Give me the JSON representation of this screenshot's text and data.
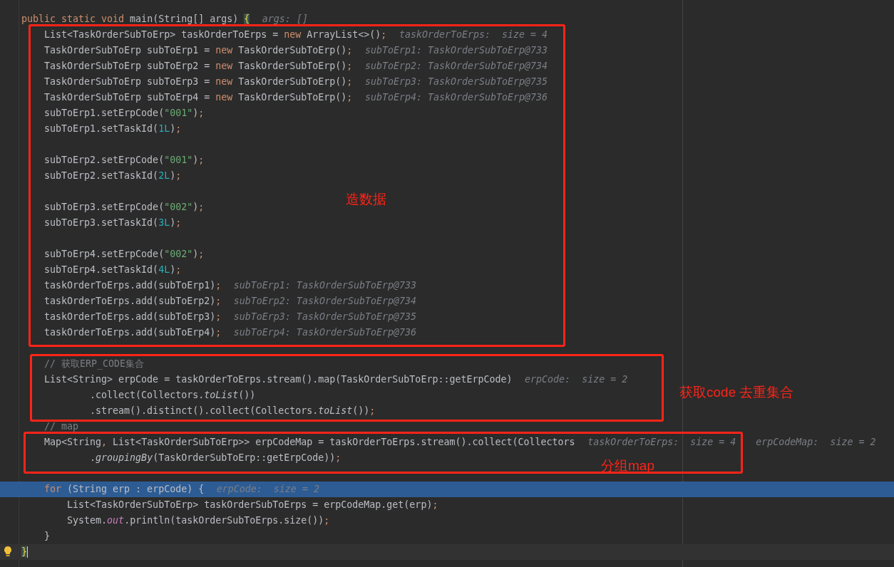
{
  "editor": {
    "lines": [
      {
        "kind": "code",
        "tokens": [
          {
            "kind": "kw",
            "text": "public static void "
          },
          {
            "kind": "p",
            "text": "main(String[] args) "
          },
          {
            "kind": "brace",
            "text": "{"
          }
        ],
        "hints": [
          "args: []"
        ]
      },
      {
        "kind": "code",
        "tokens": [
          {
            "kind": "p",
            "text": "    List<TaskOrderSubToErp> taskOrderToErps = "
          },
          {
            "kind": "kw",
            "text": "new "
          },
          {
            "kind": "p",
            "text": "ArrayList<>()"
          },
          {
            "kind": "kw",
            "text": ";"
          }
        ],
        "hints": [
          "taskOrderToErps:  size = 4"
        ]
      },
      {
        "kind": "code",
        "tokens": [
          {
            "kind": "p",
            "text": "    TaskOrderSubToErp subToErp1 = "
          },
          {
            "kind": "kw",
            "text": "new "
          },
          {
            "kind": "p",
            "text": "TaskOrderSubToErp()"
          },
          {
            "kind": "kw",
            "text": ";"
          }
        ],
        "hints": [
          "subToErp1: TaskOrderSubToErp@733"
        ]
      },
      {
        "kind": "code",
        "tokens": [
          {
            "kind": "p",
            "text": "    TaskOrderSubToErp subToErp2 = "
          },
          {
            "kind": "kw",
            "text": "new "
          },
          {
            "kind": "p",
            "text": "TaskOrderSubToErp()"
          },
          {
            "kind": "kw",
            "text": ";"
          }
        ],
        "hints": [
          "subToErp2: TaskOrderSubToErp@734"
        ]
      },
      {
        "kind": "code",
        "tokens": [
          {
            "kind": "p",
            "text": "    TaskOrderSubToErp subToErp3 = "
          },
          {
            "kind": "kw",
            "text": "new "
          },
          {
            "kind": "p",
            "text": "TaskOrderSubToErp()"
          },
          {
            "kind": "kw",
            "text": ";"
          }
        ],
        "hints": [
          "subToErp3: TaskOrderSubToErp@735"
        ]
      },
      {
        "kind": "code",
        "tokens": [
          {
            "kind": "p",
            "text": "    TaskOrderSubToErp subToErp4 = "
          },
          {
            "kind": "kw",
            "text": "new "
          },
          {
            "kind": "p",
            "text": "TaskOrderSubToErp()"
          },
          {
            "kind": "kw",
            "text": ";"
          }
        ],
        "hints": [
          "subToErp4: TaskOrderSubToErp@736"
        ]
      },
      {
        "kind": "code",
        "tokens": [
          {
            "kind": "p",
            "text": "    subToErp1.setErpCode("
          },
          {
            "kind": "str",
            "text": "\"001\""
          },
          {
            "kind": "p",
            "text": ")"
          },
          {
            "kind": "kw",
            "text": ";"
          }
        ]
      },
      {
        "kind": "code",
        "tokens": [
          {
            "kind": "p",
            "text": "    subToErp1.setTaskId("
          },
          {
            "kind": "num",
            "text": "1L"
          },
          {
            "kind": "p",
            "text": ")"
          },
          {
            "kind": "kw",
            "text": ";"
          }
        ]
      },
      {
        "kind": "blank"
      },
      {
        "kind": "code",
        "tokens": [
          {
            "kind": "p",
            "text": "    subToErp2.setErpCode("
          },
          {
            "kind": "str",
            "text": "\"001\""
          },
          {
            "kind": "p",
            "text": ")"
          },
          {
            "kind": "kw",
            "text": ";"
          }
        ]
      },
      {
        "kind": "code",
        "tokens": [
          {
            "kind": "p",
            "text": "    subToErp2.setTaskId("
          },
          {
            "kind": "num",
            "text": "2L"
          },
          {
            "kind": "p",
            "text": ")"
          },
          {
            "kind": "kw",
            "text": ";"
          }
        ]
      },
      {
        "kind": "blank"
      },
      {
        "kind": "code",
        "tokens": [
          {
            "kind": "p",
            "text": "    subToErp3.setErpCode("
          },
          {
            "kind": "str",
            "text": "\"002\""
          },
          {
            "kind": "p",
            "text": ")"
          },
          {
            "kind": "kw",
            "text": ";"
          }
        ]
      },
      {
        "kind": "code",
        "tokens": [
          {
            "kind": "p",
            "text": "    subToErp3.setTaskId("
          },
          {
            "kind": "num",
            "text": "3L"
          },
          {
            "kind": "p",
            "text": ")"
          },
          {
            "kind": "kw",
            "text": ";"
          }
        ]
      },
      {
        "kind": "blank"
      },
      {
        "kind": "code",
        "tokens": [
          {
            "kind": "p",
            "text": "    subToErp4.setErpCode("
          },
          {
            "kind": "str",
            "text": "\"002\""
          },
          {
            "kind": "p",
            "text": ")"
          },
          {
            "kind": "kw",
            "text": ";"
          }
        ]
      },
      {
        "kind": "code",
        "tokens": [
          {
            "kind": "p",
            "text": "    subToErp4.setTaskId("
          },
          {
            "kind": "num",
            "text": "4L"
          },
          {
            "kind": "p",
            "text": ")"
          },
          {
            "kind": "kw",
            "text": ";"
          }
        ]
      },
      {
        "kind": "code",
        "tokens": [
          {
            "kind": "p",
            "text": "    taskOrderToErps.add(subToErp1)"
          },
          {
            "kind": "kw",
            "text": ";"
          }
        ],
        "hints": [
          "subToErp1: TaskOrderSubToErp@733"
        ]
      },
      {
        "kind": "code",
        "tokens": [
          {
            "kind": "p",
            "text": "    taskOrderToErps.add(subToErp2)"
          },
          {
            "kind": "kw",
            "text": ";"
          }
        ],
        "hints": [
          "subToErp2: TaskOrderSubToErp@734"
        ]
      },
      {
        "kind": "code",
        "tokens": [
          {
            "kind": "p",
            "text": "    taskOrderToErps.add(subToErp3)"
          },
          {
            "kind": "kw",
            "text": ";"
          }
        ],
        "hints": [
          "subToErp3: TaskOrderSubToErp@735"
        ]
      },
      {
        "kind": "code",
        "tokens": [
          {
            "kind": "p",
            "text": "    taskOrderToErps.add(subToErp4)"
          },
          {
            "kind": "kw",
            "text": ";"
          }
        ],
        "hints": [
          "subToErp4: TaskOrderSubToErp@736"
        ]
      },
      {
        "kind": "blank"
      },
      {
        "kind": "code",
        "tokens": [
          {
            "kind": "cm",
            "text": "    // 获取ERP_CODE集合"
          }
        ]
      },
      {
        "kind": "code",
        "tokens": [
          {
            "kind": "p",
            "text": "    List<String> erpCode = taskOrderToErps.stream().map(TaskOrderSubToErp::getErpCode)"
          }
        ],
        "hints": [
          "erpCode:  size = 2"
        ]
      },
      {
        "kind": "code",
        "tokens": [
          {
            "kind": "p",
            "text": "            .collect(Collectors."
          },
          {
            "kind": "it",
            "text": "toList"
          },
          {
            "kind": "p",
            "text": "())"
          }
        ]
      },
      {
        "kind": "code",
        "tokens": [
          {
            "kind": "p",
            "text": "            .stream().distinct().collect(Collectors."
          },
          {
            "kind": "it",
            "text": "toList"
          },
          {
            "kind": "p",
            "text": "())"
          },
          {
            "kind": "kw",
            "text": ";"
          }
        ]
      },
      {
        "kind": "code",
        "tokens": [
          {
            "kind": "cm",
            "text": "    // map"
          }
        ]
      },
      {
        "kind": "code",
        "tokens": [
          {
            "kind": "p",
            "text": "    Map<String"
          },
          {
            "kind": "kw",
            "text": ","
          },
          {
            "kind": "p",
            "text": " List<TaskOrderSubToErp>> erpCodeMap = taskOrderToErps.stream().collect(Collectors"
          }
        ],
        "hints": [
          "taskOrderToErps:  size = 4",
          "erpCodeMap:  size = 2"
        ]
      },
      {
        "kind": "code",
        "tokens": [
          {
            "kind": "p",
            "text": "            ."
          },
          {
            "kind": "it",
            "text": "groupingBy"
          },
          {
            "kind": "p",
            "text": "(TaskOrderSubToErp::getErpCode))"
          },
          {
            "kind": "kw",
            "text": ";"
          }
        ]
      },
      {
        "kind": "blank"
      },
      {
        "kind": "execution",
        "tokens": [
          {
            "kind": "kw",
            "text": "    for "
          },
          {
            "kind": "p",
            "text": "(String erp : erpCode) {"
          }
        ],
        "hints": [
          "erpCode:  size = 2"
        ]
      },
      {
        "kind": "code",
        "tokens": [
          {
            "kind": "p",
            "text": "        List<TaskOrderSubToErp> taskOrderSubToErps = erpCodeMap.get(erp)"
          },
          {
            "kind": "kw",
            "text": ";"
          }
        ]
      },
      {
        "kind": "code",
        "tokens": [
          {
            "kind": "p",
            "text": "        System."
          },
          {
            "kind": "field",
            "text": "out"
          },
          {
            "kind": "p",
            "text": ".println(taskOrderSubToErps.size())"
          },
          {
            "kind": "kw",
            "text": ";"
          }
        ]
      },
      {
        "kind": "code",
        "tokens": [
          {
            "kind": "p",
            "text": "    }"
          }
        ]
      },
      {
        "kind": "caret",
        "tokens": [
          {
            "kind": "brace",
            "text": "}"
          }
        ]
      }
    ]
  },
  "annotations": [
    {
      "label": "造数据"
    },
    {
      "label": "获取code 去重集合"
    },
    {
      "label": "分组map"
    }
  ]
}
